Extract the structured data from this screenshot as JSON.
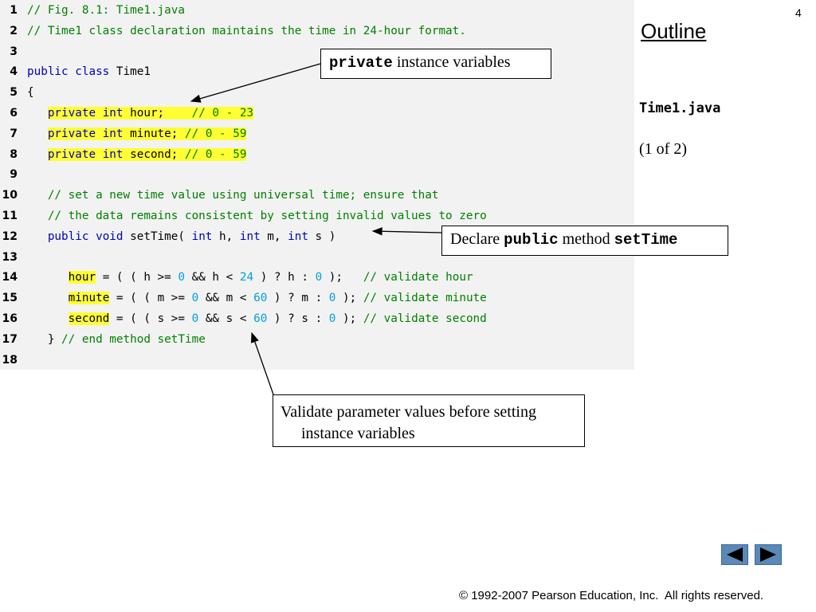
{
  "slide_number": "4",
  "sidebar": {
    "outline_label": "Outline",
    "file_name": "Time1.java",
    "part": "(1 of 2)"
  },
  "code": {
    "lines": [
      {
        "n": "1",
        "segs": [
          {
            "t": "// Fig. 8.1: Time1.java",
            "c": "cm"
          }
        ]
      },
      {
        "n": "2",
        "segs": [
          {
            "t": "// Time1 class declaration maintains the time in 24-hour format.",
            "c": "cm"
          }
        ]
      },
      {
        "n": "3",
        "segs": []
      },
      {
        "n": "4",
        "segs": [
          {
            "t": "public class",
            "c": "kw"
          },
          {
            "t": " Time1",
            "c": ""
          }
        ]
      },
      {
        "n": "5",
        "segs": [
          {
            "t": "{",
            "c": ""
          }
        ]
      },
      {
        "n": "6",
        "segs": [
          {
            "t": "   ",
            "c": ""
          },
          {
            "t": "private int",
            "c": "kw hl"
          },
          {
            "t": " hour;   ",
            "c": "hl"
          },
          {
            "t": " // 0 - 23",
            "c": "cm hl"
          }
        ]
      },
      {
        "n": "7",
        "segs": [
          {
            "t": "   ",
            "c": ""
          },
          {
            "t": "private int",
            "c": "kw hl"
          },
          {
            "t": " minute;",
            "c": "hl"
          },
          {
            "t": " // 0 - 59",
            "c": "cm hl"
          }
        ]
      },
      {
        "n": "8",
        "segs": [
          {
            "t": "   ",
            "c": ""
          },
          {
            "t": "private int",
            "c": "kw hl"
          },
          {
            "t": " second;",
            "c": "hl"
          },
          {
            "t": " // 0 - 59",
            "c": "cm hl"
          }
        ]
      },
      {
        "n": "9",
        "segs": []
      },
      {
        "n": "10",
        "segs": [
          {
            "t": "   // set a new time value using universal time; ensure that",
            "c": "cm"
          }
        ]
      },
      {
        "n": "11",
        "segs": [
          {
            "t": "   // the data remains consistent by setting invalid values to zero",
            "c": "cm"
          }
        ]
      },
      {
        "n": "12",
        "segs": [
          {
            "t": "   ",
            "c": ""
          },
          {
            "t": "public void",
            "c": "kw"
          },
          {
            "t": " setTime( ",
            "c": ""
          },
          {
            "t": "int",
            "c": "kw"
          },
          {
            "t": " h, ",
            "c": ""
          },
          {
            "t": "int",
            "c": "kw"
          },
          {
            "t": " m, ",
            "c": ""
          },
          {
            "t": "int",
            "c": "kw"
          },
          {
            "t": " s )",
            "c": ""
          }
        ]
      },
      {
        "n": "13",
        "segs": []
      },
      {
        "n": "14",
        "segs": [
          {
            "t": "      ",
            "c": ""
          },
          {
            "t": "hour",
            "c": "hl"
          },
          {
            "t": " = ( ( h >= ",
            "c": ""
          },
          {
            "t": "0",
            "c": "nm"
          },
          {
            "t": " && h < ",
            "c": ""
          },
          {
            "t": "24",
            "c": "nm"
          },
          {
            "t": " ) ? h : ",
            "c": ""
          },
          {
            "t": "0",
            "c": "nm"
          },
          {
            "t": " );   ",
            "c": ""
          },
          {
            "t": "// validate hour",
            "c": "cm"
          }
        ]
      },
      {
        "n": "15",
        "segs": [
          {
            "t": "      ",
            "c": ""
          },
          {
            "t": "minute",
            "c": "hl"
          },
          {
            "t": " = ( ( m >= ",
            "c": ""
          },
          {
            "t": "0",
            "c": "nm"
          },
          {
            "t": " && m < ",
            "c": ""
          },
          {
            "t": "60",
            "c": "nm"
          },
          {
            "t": " ) ? m : ",
            "c": ""
          },
          {
            "t": "0",
            "c": "nm"
          },
          {
            "t": " ); ",
            "c": ""
          },
          {
            "t": "// validate minute",
            "c": "cm"
          }
        ]
      },
      {
        "n": "16",
        "segs": [
          {
            "t": "      ",
            "c": ""
          },
          {
            "t": "second",
            "c": "hl"
          },
          {
            "t": " = ( ( s >= ",
            "c": ""
          },
          {
            "t": "0",
            "c": "nm"
          },
          {
            "t": " && s < ",
            "c": ""
          },
          {
            "t": "60",
            "c": "nm"
          },
          {
            "t": " ) ? s : ",
            "c": ""
          },
          {
            "t": "0",
            "c": "nm"
          },
          {
            "t": " ); ",
            "c": ""
          },
          {
            "t": "// validate second",
            "c": "cm"
          }
        ]
      },
      {
        "n": "17",
        "segs": [
          {
            "t": "   } ",
            "c": ""
          },
          {
            "t": "// end method setTime",
            "c": "cm"
          }
        ]
      },
      {
        "n": "18",
        "segs": []
      }
    ]
  },
  "callouts": {
    "private": {
      "mono": "private",
      "rest": " instance variables"
    },
    "public": {
      "pre": "Declare ",
      "mono1": "public",
      "mid": " method ",
      "mono2": "setTime"
    },
    "validate": {
      "line1": "Validate parameter values before setting",
      "line2": "instance variables"
    }
  },
  "nav": {
    "prev_icon": "triangle-left-icon",
    "next_icon": "triangle-right-icon"
  },
  "footer": {
    "copyright": "© 1992-2007 Pearson Education, Inc.  All rights reserved."
  },
  "colors": {
    "keyword": "#0000c0",
    "comment": "#008000",
    "number": "#00a0e0",
    "highlight": "#ffff33",
    "nav": "#5a88b8"
  }
}
